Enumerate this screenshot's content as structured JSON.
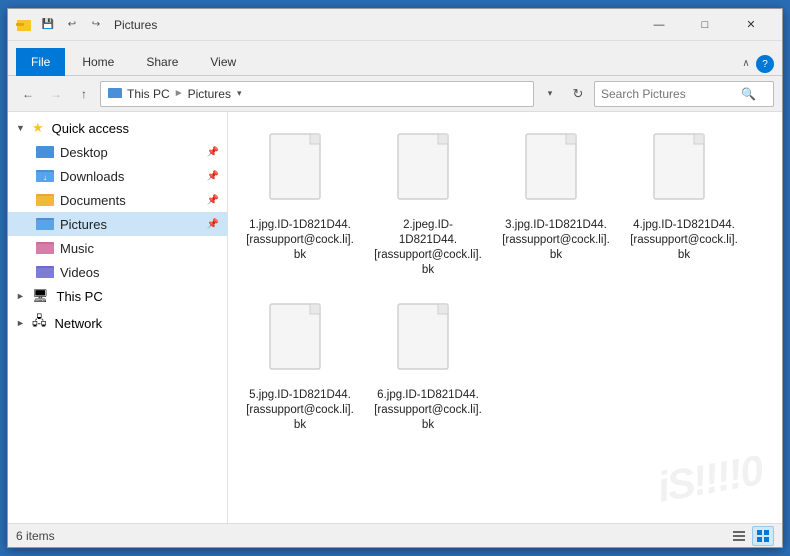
{
  "window": {
    "title": "Pictures",
    "icon": "folder-icon"
  },
  "titlebar": {
    "qat": [
      "undo-icon",
      "redo-icon",
      "properties-icon",
      "dropdown-icon"
    ],
    "controls": {
      "minimize": "—",
      "maximize": "□",
      "close": "✕"
    }
  },
  "ribbon": {
    "tabs": [
      "File",
      "Home",
      "Share",
      "View"
    ],
    "active_tab": "File"
  },
  "addressbar": {
    "back_disabled": false,
    "forward_disabled": true,
    "breadcrumbs": [
      "This PC",
      "Pictures"
    ],
    "search_placeholder": "Search Pictures"
  },
  "sidebar": {
    "sections": [
      {
        "id": "quick-access",
        "label": "Quick access",
        "expanded": true,
        "items": [
          {
            "id": "desktop",
            "label": "Desktop",
            "icon": "desktop-folder",
            "pinned": true
          },
          {
            "id": "downloads",
            "label": "Downloads",
            "icon": "download-folder",
            "pinned": true
          },
          {
            "id": "documents",
            "label": "Documents",
            "icon": "docs-folder",
            "pinned": true
          },
          {
            "id": "pictures",
            "label": "Pictures",
            "icon": "pictures-folder",
            "pinned": true,
            "active": true
          },
          {
            "id": "music",
            "label": "Music",
            "icon": "music-folder",
            "pinned": false
          },
          {
            "id": "videos",
            "label": "Videos",
            "icon": "video-folder",
            "pinned": false
          }
        ]
      },
      {
        "id": "this-pc",
        "label": "This PC",
        "expanded": false,
        "items": []
      },
      {
        "id": "network",
        "label": "Network",
        "expanded": false,
        "items": []
      }
    ]
  },
  "files": [
    {
      "id": "file1",
      "name": "1.jpg.ID-1D821D44.[rassupport@cock.li].bk"
    },
    {
      "id": "file2",
      "name": "2.jpeg.ID-1D821D44.[rassupport@cock.li].bk"
    },
    {
      "id": "file3",
      "name": "3.jpg.ID-1D821D44.[rassupport@cock.li].bk"
    },
    {
      "id": "file4",
      "name": "4.jpg.ID-1D821D44.[rassupport@cock.li].bk"
    },
    {
      "id": "file5",
      "name": "5.jpg.ID-1D821D44.[rassupport@cock.li].bk"
    },
    {
      "id": "file6",
      "name": "6.jpg.ID-1D821D44.[rassupport@cock.li].bk"
    }
  ],
  "statusbar": {
    "item_count": "6 items"
  },
  "watermark": "iS!!!!0"
}
